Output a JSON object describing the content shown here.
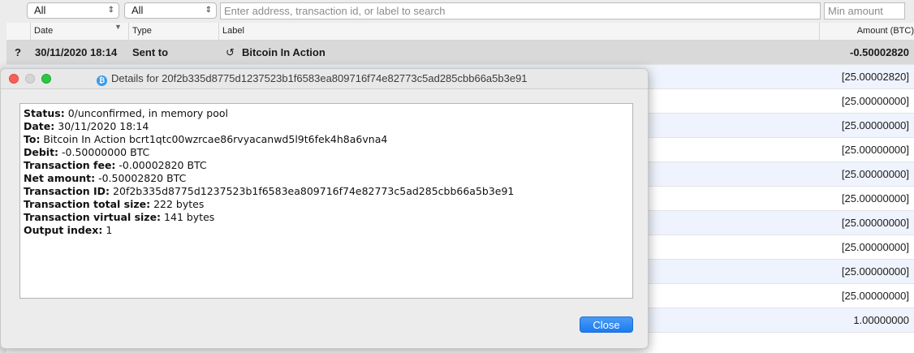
{
  "filters": {
    "type_filter": "All",
    "date_filter": "All",
    "search_placeholder": "Enter address, transaction id, or label to search",
    "min_amount_placeholder": "Min amount"
  },
  "table": {
    "columns": {
      "date": "Date",
      "type": "Type",
      "label": "Label",
      "amount": "Amount (BTC)"
    },
    "selected_row": {
      "status": "?",
      "date": "30/11/2020 18:14",
      "type": "Sent to",
      "label": "Bitcoin In Action",
      "amount": "-0.50002820"
    },
    "rows": [
      {
        "amount": "[25.00002820]"
      },
      {
        "amount": "[25.00000000]"
      },
      {
        "amount": "[25.00000000]"
      },
      {
        "amount": "[25.00000000]"
      },
      {
        "amount": "[25.00000000]"
      },
      {
        "amount": "[25.00000000]"
      },
      {
        "amount": "[25.00000000]"
      },
      {
        "amount": "[25.00000000]"
      },
      {
        "amount": "[25.00000000]"
      },
      {
        "amount": "[25.00000000]"
      },
      {
        "amount": "1.00000000"
      }
    ]
  },
  "dialog": {
    "title": "Details for 20f2b335d8775d1237523b1f6583ea809716f74e82773c5ad285cbb66a5b3e91",
    "fields": [
      {
        "label": "Status:",
        "value": " 0/unconfirmed, in memory pool"
      },
      {
        "label": "Date:",
        "value": " 30/11/2020 18:14"
      },
      {
        "label": "To:",
        "value": " Bitcoin In Action bcrt1qtc00wzrcae86rvyacanwd5l9t6fek4h8a6vna4"
      },
      {
        "label": "Debit:",
        "value": " -0.50000000 BTC"
      },
      {
        "label": "Transaction fee:",
        "value": " -0.00002820 BTC"
      },
      {
        "label": "Net amount:",
        "value": " -0.50002820 BTC"
      },
      {
        "label": "Transaction ID:",
        "value": " 20f2b335d8775d1237523b1f6583ea809716f74e82773c5ad285cbb66a5b3e91"
      },
      {
        "label": "Transaction total size:",
        "value": " 222 bytes"
      },
      {
        "label": "Transaction virtual size:",
        "value": " 141 bytes"
      },
      {
        "label": "Output index:",
        "value": " 1"
      }
    ],
    "close_label": "Close"
  },
  "colors": {
    "selected_row": "#d9d9d9",
    "alt_row": "#eef3fd",
    "accent_button": "#1c7bf0",
    "traffic_close": "#fc5f57",
    "traffic_max": "#2ac840"
  }
}
